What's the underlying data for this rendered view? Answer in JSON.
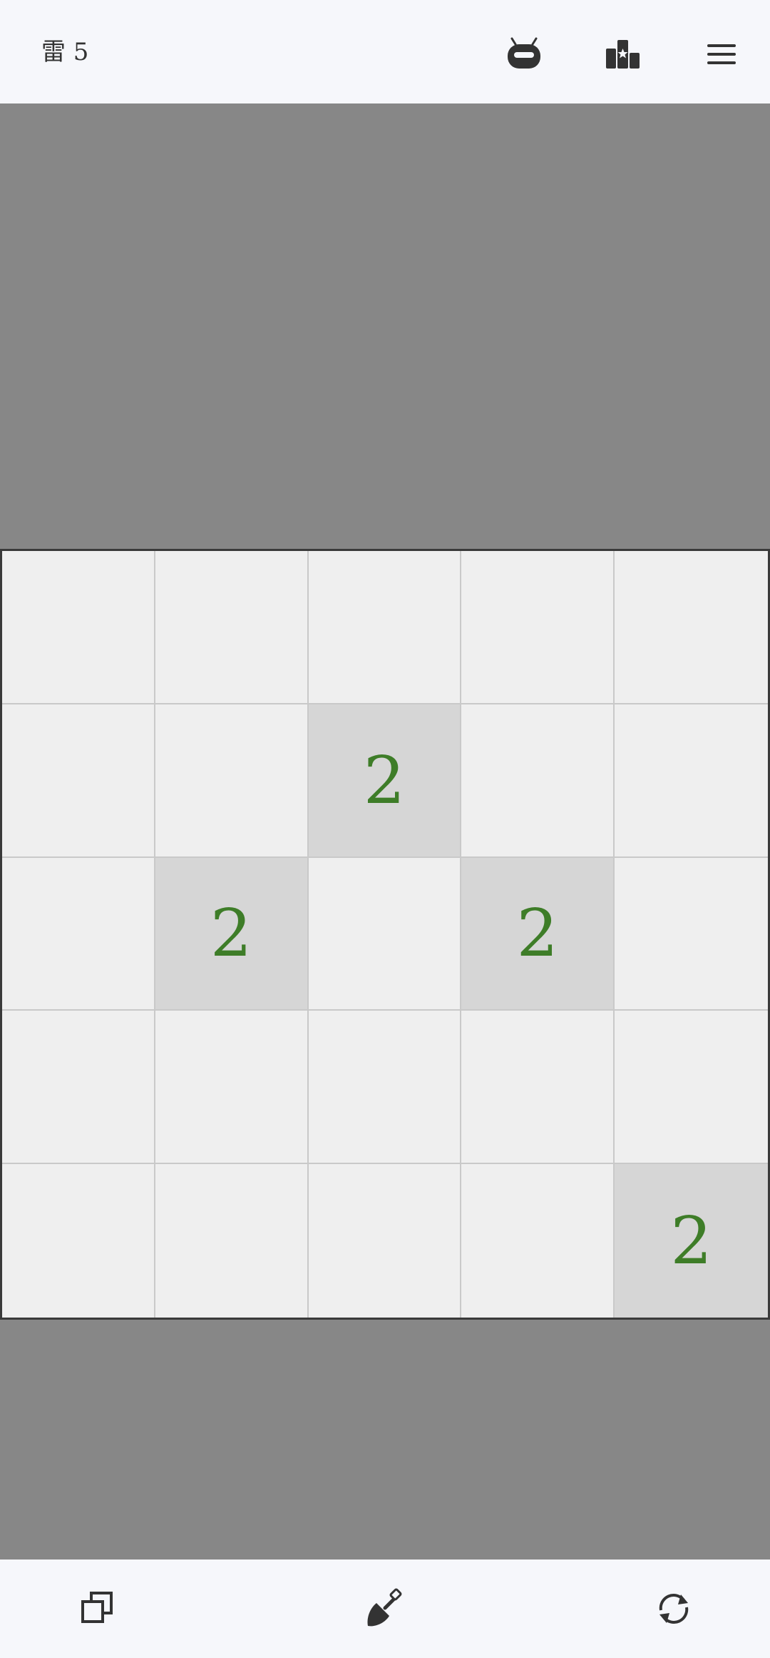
{
  "header": {
    "mine_label": "雷 5",
    "icons": {
      "robot": "robot-icon",
      "leaderboard": "leaderboard-icon",
      "menu": "menu-icon"
    }
  },
  "board": {
    "rows": 5,
    "cols": 5,
    "cells": [
      [
        "",
        "",
        "",
        "",
        ""
      ],
      [
        "",
        "",
        "2",
        "",
        ""
      ],
      [
        "",
        "2",
        "",
        "2",
        ""
      ],
      [
        "",
        "",
        "",
        "",
        ""
      ],
      [
        "",
        "",
        "",
        "",
        "2"
      ]
    ],
    "revealed": [
      [
        false,
        false,
        false,
        false,
        false
      ],
      [
        false,
        false,
        true,
        false,
        false
      ],
      [
        false,
        true,
        false,
        true,
        false
      ],
      [
        false,
        false,
        false,
        false,
        false
      ],
      [
        false,
        false,
        false,
        false,
        true
      ]
    ],
    "colors": {
      "hidden_cell": "#efefef",
      "revealed_cell": "#d6d6d6",
      "number": "#3e7d28",
      "background": "#878787"
    }
  },
  "footer": {
    "icons": {
      "copy": "copy-icon",
      "dig": "shovel-icon",
      "restart": "restart-icon"
    }
  }
}
